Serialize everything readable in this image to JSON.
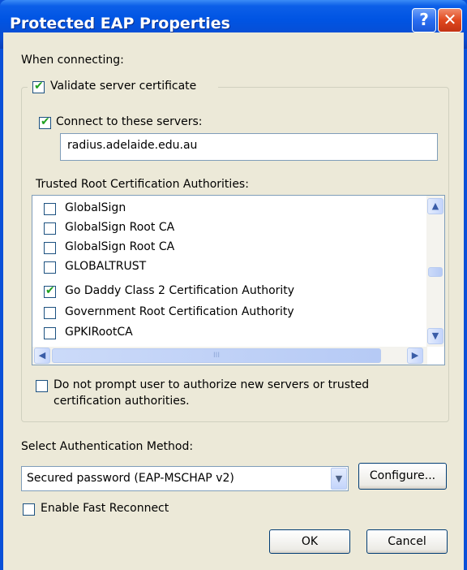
{
  "window": {
    "title": "Protected EAP Properties",
    "help_glyph": "?",
    "close_glyph": "✕"
  },
  "when_connecting": "When connecting:",
  "validate_cert": {
    "label": "Validate server certificate",
    "checked": true
  },
  "connect_servers": {
    "label": "Connect to these servers:",
    "checked": true
  },
  "servers_value": "radius.adelaide.edu.au",
  "trusted_label": "Trusted Root Certification Authorities:",
  "ca_list": [
    {
      "label": "GlobalSign",
      "checked": false
    },
    {
      "label": "GlobalSign Root CA",
      "checked": false
    },
    {
      "label": "GlobalSign Root CA",
      "checked": false
    },
    {
      "label": "GLOBALTRUST",
      "checked": false
    },
    {
      "label": "Go Daddy Class 2 Certification Authority",
      "checked": true
    },
    {
      "label": "Government Root Certification Authority",
      "checked": false
    },
    {
      "label": "GPKIRootCA",
      "checked": false
    }
  ],
  "do_not_prompt": {
    "line1": "Do not prompt user to authorize new servers or trusted",
    "line2": "certification authorities.",
    "checked": false
  },
  "auth_method_label": "Select Authentication Method:",
  "auth_method_value": "Secured password (EAP-MSCHAP v2)",
  "configure_label": "Configure...",
  "fast_reconnect": {
    "label": "Enable Fast Reconnect",
    "checked": false
  },
  "ok_label": "OK",
  "cancel_label": "Cancel",
  "check_glyph": "✔",
  "icons": {
    "scroll_up": "▲",
    "scroll_down": "▼",
    "scroll_left": "◀",
    "scroll_right": "▶",
    "grip": "III",
    "combo_arrow": "▼"
  }
}
